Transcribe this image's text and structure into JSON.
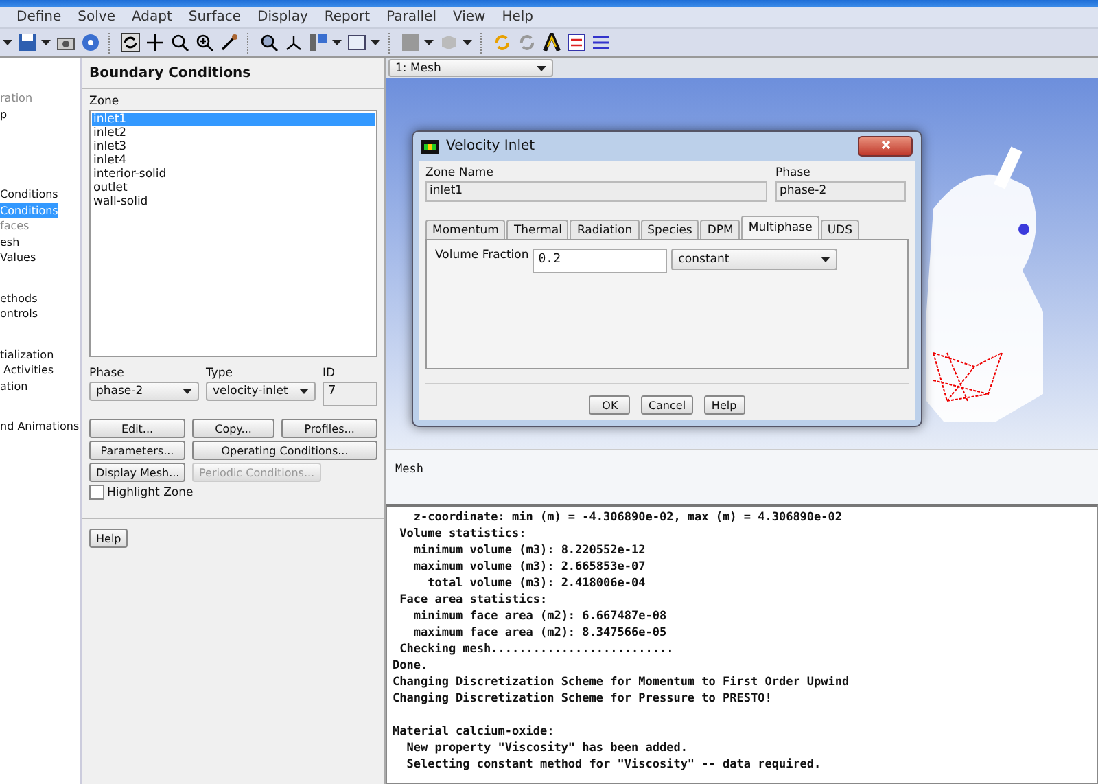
{
  "menu_bar": [
    "Define",
    "Solve",
    "Adapt",
    "Surface",
    "Display",
    "Report",
    "Parallel",
    "View",
    "Help"
  ],
  "tree": {
    "groups": [
      [
        {
          "label": "ration",
          "selected": false,
          "disabled": true
        },
        {
          "label": "p",
          "selected": false,
          "disabled": false
        }
      ],
      [
        {
          "label": "Conditions",
          "selected": false,
          "disabled": false
        },
        {
          "label": "Conditions",
          "selected": true,
          "disabled": false
        },
        {
          "label": "faces",
          "selected": false,
          "disabled": true
        },
        {
          "label": "esh",
          "selected": false,
          "disabled": false
        },
        {
          "label": "Values",
          "selected": false,
          "disabled": false
        }
      ],
      [
        {
          "label": "ethods",
          "selected": false,
          "disabled": false
        },
        {
          "label": "ontrols",
          "selected": false,
          "disabled": false
        }
      ],
      [
        {
          "label": "tialization",
          "selected": false,
          "disabled": false
        },
        {
          "label": " Activities",
          "selected": false,
          "disabled": false
        },
        {
          "label": "ation",
          "selected": false,
          "disabled": false
        }
      ],
      [
        {
          "label": "nd Animations",
          "selected": false,
          "disabled": false
        }
      ]
    ]
  },
  "boundary_conditions": {
    "title": "Boundary Conditions",
    "zone_label": "Zone",
    "zones": [
      {
        "label": "inlet1",
        "selected": true
      },
      {
        "label": "inlet2",
        "selected": false
      },
      {
        "label": "inlet3",
        "selected": false
      },
      {
        "label": "inlet4",
        "selected": false
      },
      {
        "label": "interior-solid",
        "selected": false
      },
      {
        "label": "outlet",
        "selected": false
      },
      {
        "label": "wall-solid",
        "selected": false
      }
    ],
    "phase": {
      "label": "Phase",
      "value": "phase-2"
    },
    "type": {
      "label": "Type",
      "value": "velocity-inlet"
    },
    "id": {
      "label": "ID",
      "value": "7"
    },
    "buttons": [
      {
        "label": "Edit...",
        "disabled": false
      },
      {
        "label": "Copy...",
        "disabled": false
      },
      {
        "label": "Profiles...",
        "disabled": false
      },
      {
        "label": "Parameters...",
        "disabled": false
      },
      {
        "label": "Operating Conditions...",
        "disabled": false
      },
      {
        "label": "Display Mesh...",
        "disabled": false
      },
      {
        "label": "Periodic Conditions...",
        "disabled": true
      }
    ],
    "highlight_zone": {
      "label": "Highlight Zone",
      "checked": false
    },
    "help": "Help"
  },
  "viewport": {
    "selector": "1: Mesh",
    "caption": "Mesh"
  },
  "dialog": {
    "title": "Velocity Inlet",
    "zone_name": {
      "label": "Zone Name",
      "value": "inlet1"
    },
    "phase": {
      "label": "Phase",
      "value": "phase-2"
    },
    "tabs": [
      {
        "label": "Momentum",
        "selected": false
      },
      {
        "label": "Thermal",
        "selected": false
      },
      {
        "label": "Radiation",
        "selected": false
      },
      {
        "label": "Species",
        "selected": false
      },
      {
        "label": "DPM",
        "selected": false
      },
      {
        "label": "Multiphase",
        "selected": true
      },
      {
        "label": "UDS",
        "selected": false
      }
    ],
    "volume_fraction": {
      "label": "Volume Fraction",
      "value": "0.2",
      "method": "constant"
    },
    "buttons": [
      "OK",
      "Cancel",
      "Help"
    ]
  },
  "console": [
    [
      "   z-coordinate: min (m) = -4.306890e-02, max (m) = 4.306890e-02",
      " Volume statistics:",
      "   minimum volume (m3): 8.220552e-12",
      "   maximum volume (m3): 2.665853e-07",
      "     total volume (m3): 2.418006e-04",
      " Face area statistics:",
      "   minimum face area (m2): 6.667487e-08",
      "   maximum face area (m2): 8.347566e-05",
      " Checking mesh..........................",
      "Done.",
      "Changing Discretization Scheme for Momentum to First Order Upwind",
      "Changing Discretization Scheme for Pressure to PRESTO!"
    ],
    [
      "Material calcium-oxide:",
      "  New property \"Viscosity\" has been added.",
      "  Selecting constant method for \"Viscosity\" -- data required."
    ]
  ]
}
